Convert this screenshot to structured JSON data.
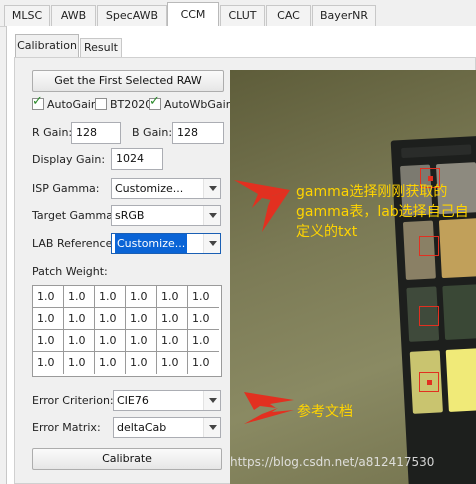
{
  "top_tabs": [
    "MLSC",
    "AWB",
    "SpecAWB",
    "CCM",
    "CLUT",
    "CAC",
    "BayerNR"
  ],
  "active_top_tab": "CCM",
  "sub_tabs": [
    "Calibration",
    "Result"
  ],
  "active_sub_tab": "Calibration",
  "get_raw_button": "Get the First Selected RAW",
  "checkboxes": {
    "autogain": {
      "label": "AutoGain",
      "checked": true
    },
    "bt2020": {
      "label": "BT2020",
      "checked": false
    },
    "autowbgain": {
      "label": "AutoWbGain",
      "checked": true
    }
  },
  "r_gain": {
    "label": "R Gain:",
    "value": "128"
  },
  "b_gain": {
    "label": "B Gain:",
    "value": "128"
  },
  "display_gain": {
    "label": "Display Gain:",
    "value": "1024"
  },
  "isp_gamma": {
    "label": "ISP Gamma:",
    "value": "Customize..."
  },
  "target_gamma": {
    "label": "Target Gamma:",
    "value": "sRGB"
  },
  "lab_reference": {
    "label": "LAB Reference:",
    "value": "Customize..."
  },
  "patch_weight": {
    "label": "Patch Weight:",
    "rows": [
      [
        "1.0",
        "1.0",
        "1.0",
        "1.0",
        "1.0",
        "1.0"
      ],
      [
        "1.0",
        "1.0",
        "1.0",
        "1.0",
        "1.0",
        "1.0"
      ],
      [
        "1.0",
        "1.0",
        "1.0",
        "1.0",
        "1.0",
        "1.0"
      ],
      [
        "1.0",
        "1.0",
        "1.0",
        "1.0",
        "1.0",
        "1.0"
      ]
    ]
  },
  "error_criterion": {
    "label": "Error Criterion:",
    "value": "CIE76"
  },
  "error_matrix": {
    "label": "Error Matrix:",
    "value": "deltaCab"
  },
  "calibrate_button": "Calibrate",
  "annotations": {
    "note1": "gamma选择刚刚获取的gamma表，lab选择自己自定义的txt",
    "note2": "参考文档"
  },
  "watermark": "https://blog.csdn.net/a812417530",
  "colors": {
    "annotation_red": "#e23020",
    "annotation_text": "#ffd400",
    "selection_blue": "#0a64d6"
  }
}
